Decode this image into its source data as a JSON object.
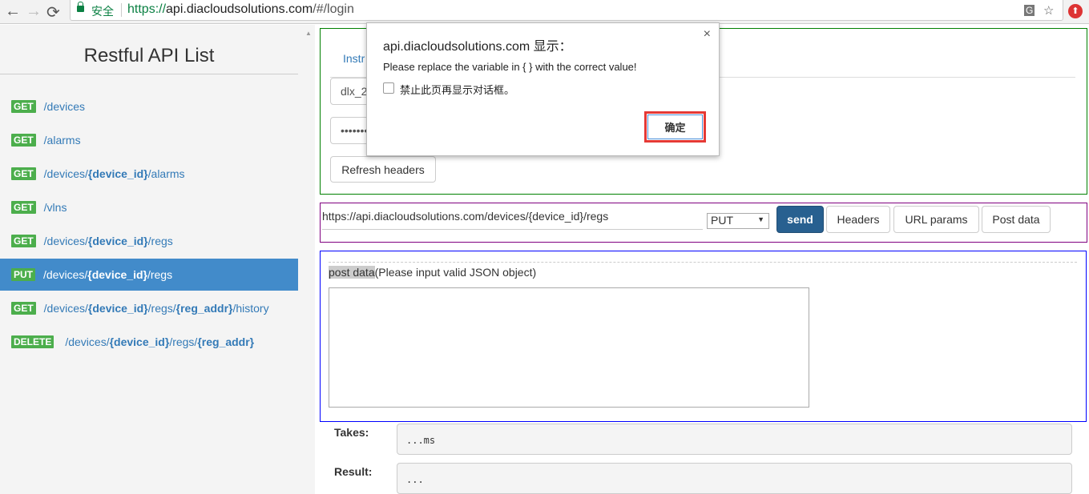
{
  "browser": {
    "back": "←",
    "forward": "→",
    "reload": "⟳",
    "secure_label": "安全",
    "url_scheme": "https://",
    "url_host": "api.diacloudsolutions.com",
    "url_path": "/#/login",
    "translate_icon": "translate-icon",
    "star": "☆",
    "ext": "⬆"
  },
  "sidebar": {
    "title": "Restful API List",
    "items": [
      {
        "method": "GET",
        "segments": [
          {
            "t": "/devices",
            "b": false
          }
        ]
      },
      {
        "method": "GET",
        "segments": [
          {
            "t": "/alarms",
            "b": false
          }
        ]
      },
      {
        "method": "GET",
        "segments": [
          {
            "t": "/devices/",
            "b": false
          },
          {
            "t": "{device_id}",
            "b": true
          },
          {
            "t": "/alarms",
            "b": false
          }
        ]
      },
      {
        "method": "GET",
        "segments": [
          {
            "t": "/vlns",
            "b": false
          }
        ]
      },
      {
        "method": "GET",
        "segments": [
          {
            "t": "/devices/",
            "b": false
          },
          {
            "t": "{device_id}",
            "b": true
          },
          {
            "t": "/regs",
            "b": false
          }
        ]
      },
      {
        "method": "PUT",
        "active": true,
        "segments": [
          {
            "t": "/devices/",
            "b": false
          },
          {
            "t": "{device_id}",
            "b": true
          },
          {
            "t": "/regs",
            "b": false
          }
        ]
      },
      {
        "method": "GET",
        "segments": [
          {
            "t": "/devices/",
            "b": false
          },
          {
            "t": "{device_id}",
            "b": true
          },
          {
            "t": "/regs/",
            "b": false
          },
          {
            "t": "{reg_addr}",
            "b": true
          },
          {
            "t": "/history",
            "b": false
          }
        ]
      },
      {
        "method": "DELETE",
        "segments": [
          {
            "t": "/devices/",
            "b": false
          },
          {
            "t": "{device_id}",
            "b": true
          },
          {
            "t": "/regs/",
            "b": false
          },
          {
            "t": "{reg_addr}",
            "b": true
          }
        ]
      }
    ]
  },
  "auth": {
    "tab": "Instr",
    "username": "dlx_2",
    "password": "•••••••",
    "refresh": "Refresh headers"
  },
  "request": {
    "url": "https://api.diacloudsolutions.com/devices/{device_id}/regs",
    "method": "PUT",
    "send": "send",
    "headers": "Headers",
    "url_params": "URL params",
    "post_data": "Post data"
  },
  "postdata": {
    "label_hl": "post data",
    "label_rest": "(Please input valid JSON object)",
    "value": ""
  },
  "response": {
    "takes_label": "Takes:",
    "takes_value": "...ms",
    "result_label": "Result:",
    "result_value": "..."
  },
  "dialog": {
    "title": "api.diacloudsolutions.com 显示：",
    "message": "Please replace the variable in { } with the correct value!",
    "checkbox_label": "禁止此页再显示对话框。",
    "ok": "确定",
    "close": "×"
  },
  "colors": {
    "get_badge": "#4cae4c",
    "active": "#428bca",
    "send": "#286090",
    "highlight": "#e53935"
  }
}
